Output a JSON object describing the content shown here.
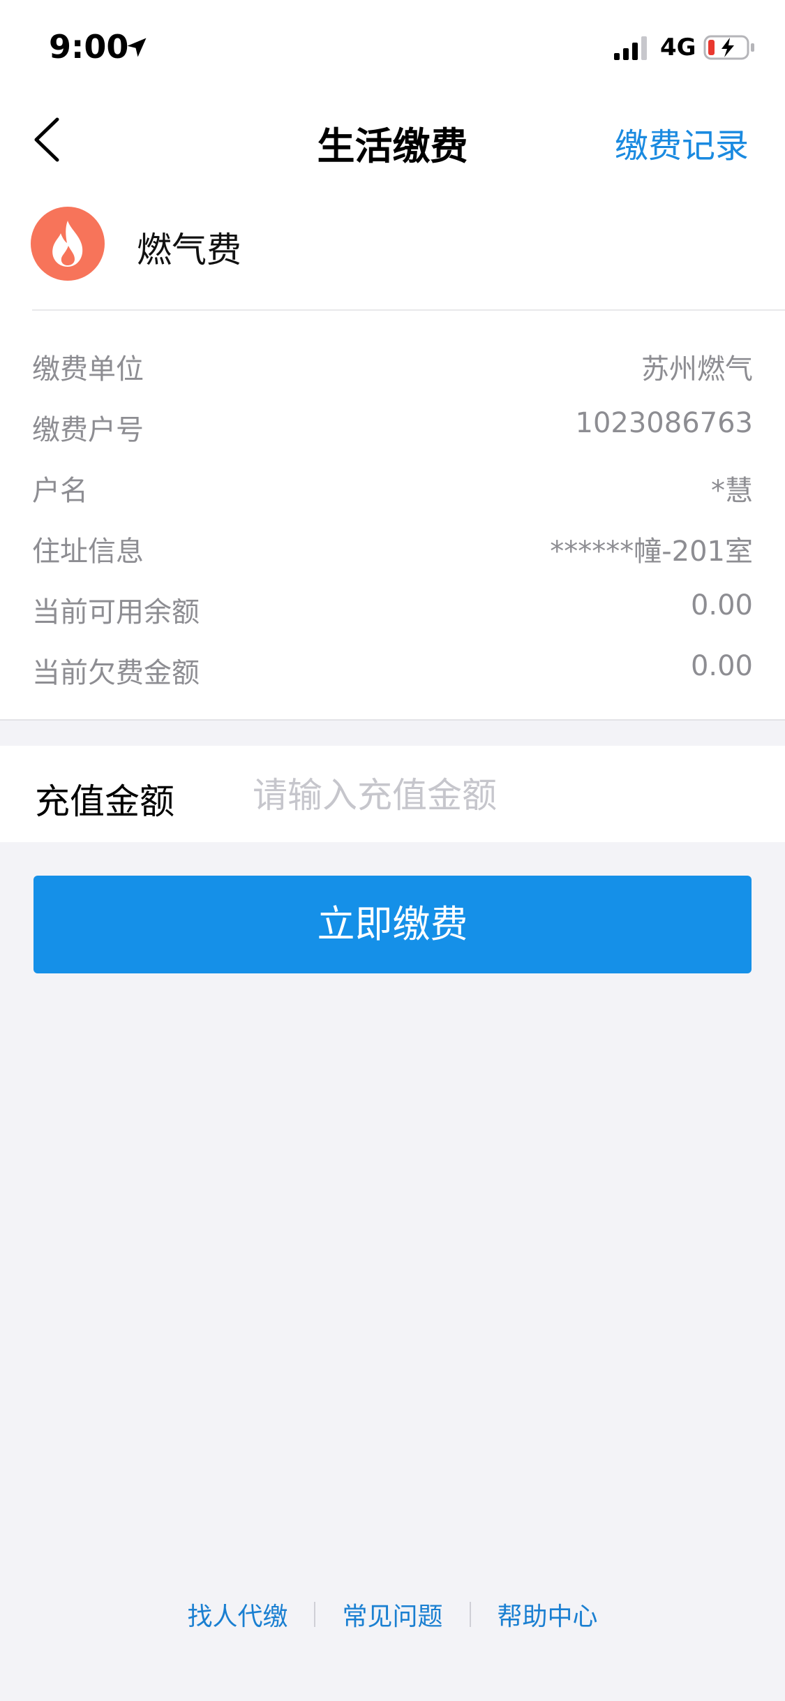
{
  "status_bar": {
    "time": "9:00",
    "network": "4G",
    "icons": [
      "location-arrow-icon",
      "signal-icon",
      "battery-charging-icon"
    ]
  },
  "nav": {
    "title": "生活缴费",
    "record_link": "缴费记录",
    "back_icon": "chevron-left-icon"
  },
  "service": {
    "name": "燃气费",
    "icon": "flame-icon",
    "icon_color": "#f7745a"
  },
  "info": [
    {
      "label": "缴费单位",
      "value": "苏州燃气"
    },
    {
      "label": "缴费户号",
      "value": "1023086763"
    },
    {
      "label": "户名",
      "value": "*慧"
    },
    {
      "label": "住址信息",
      "value": "******幢-201室"
    },
    {
      "label": "当前可用余额",
      "value": "0.00"
    },
    {
      "label": "当前欠费金额",
      "value": "0.00"
    }
  ],
  "amount": {
    "label": "充值金额",
    "value": "",
    "placeholder": "请输入充值金额"
  },
  "pay_button": {
    "label": "立即缴费",
    "color": "#1590e8"
  },
  "footer": {
    "links": [
      "找人代缴",
      "常见问题",
      "帮助中心"
    ]
  }
}
